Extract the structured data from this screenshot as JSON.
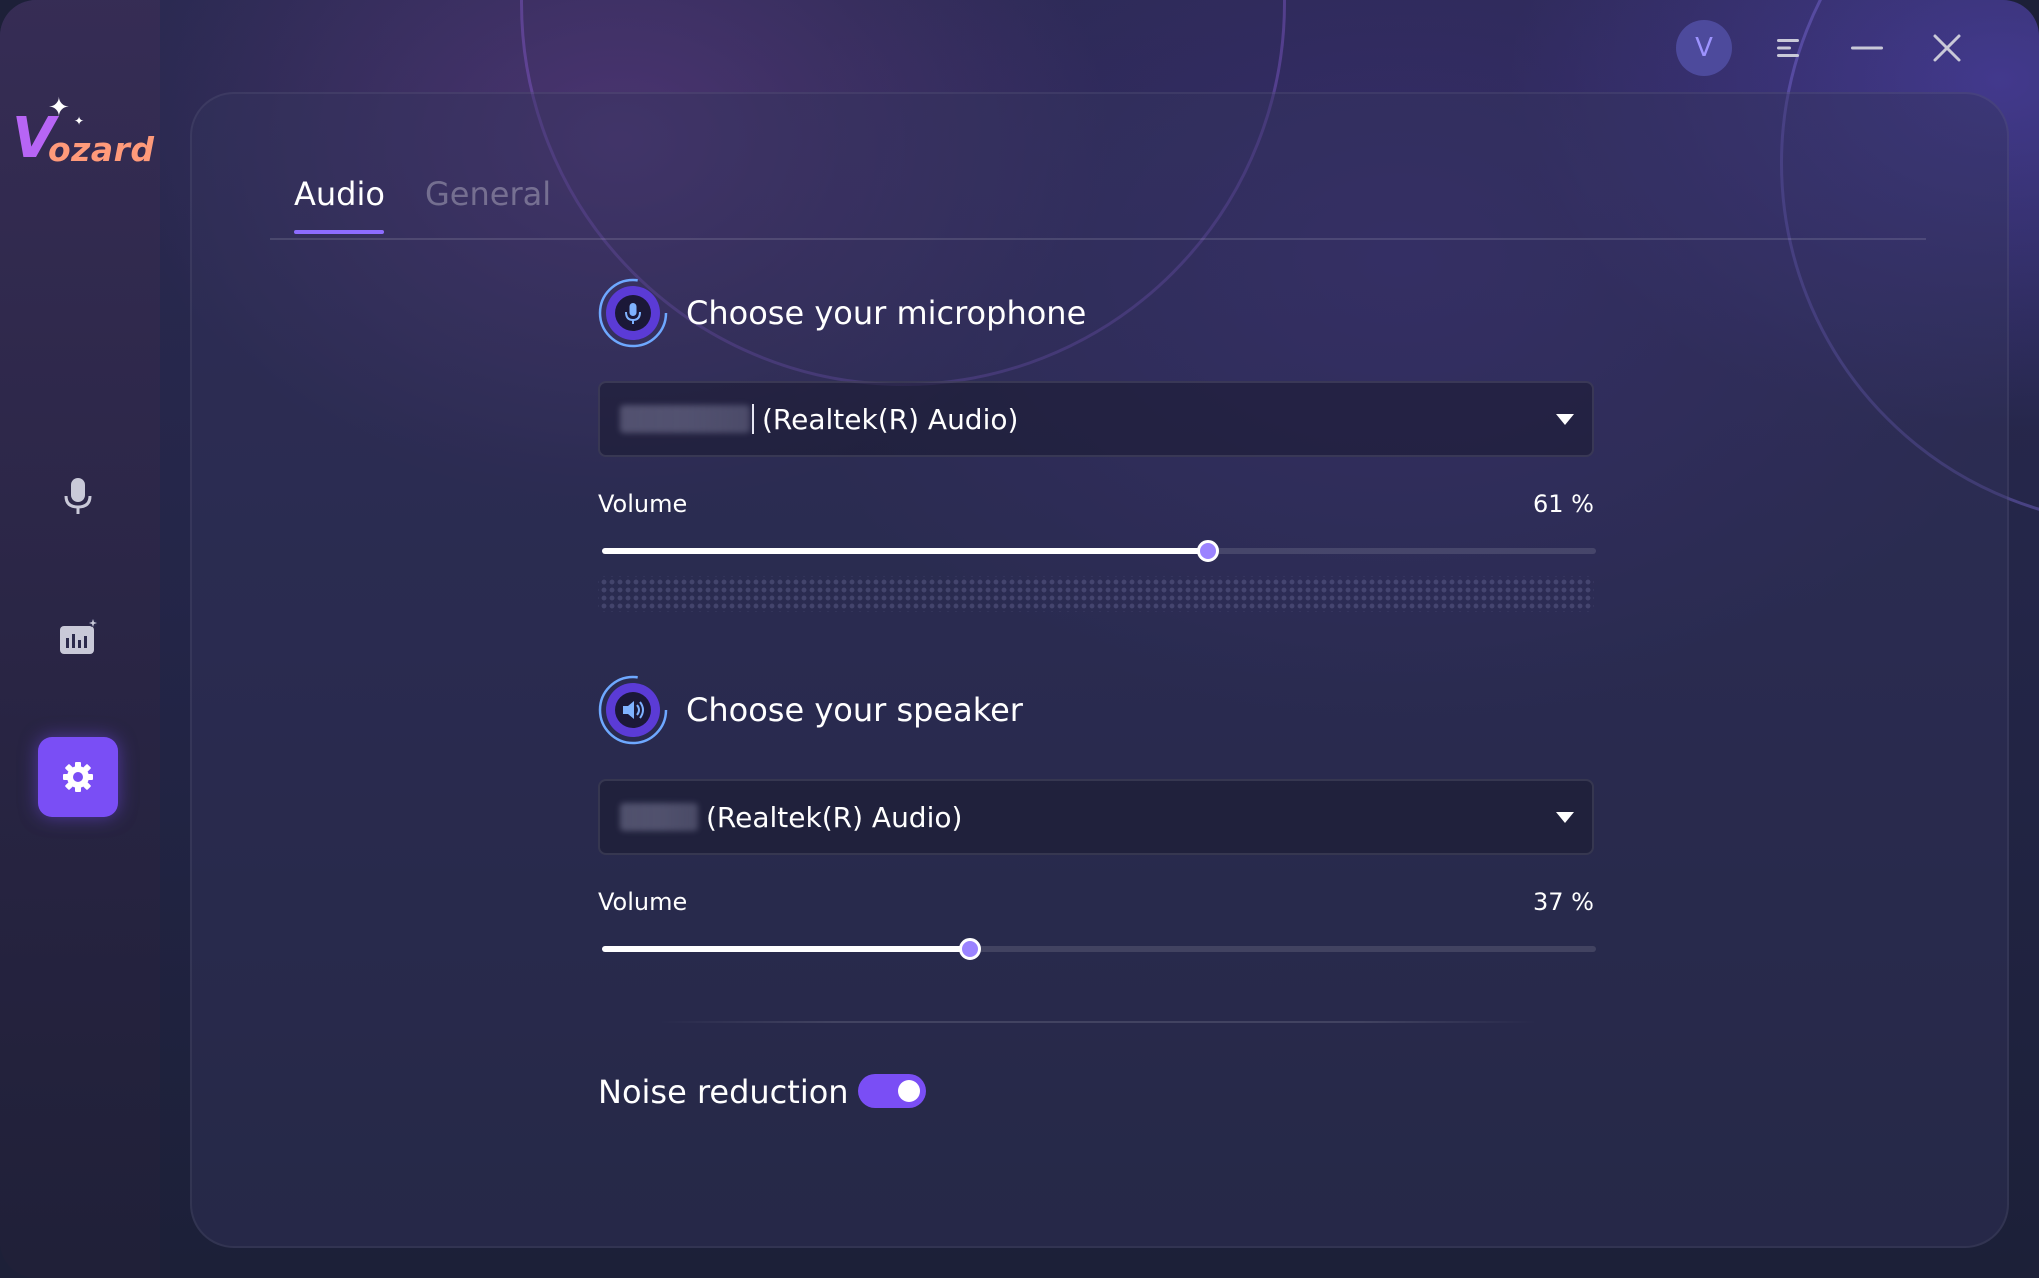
{
  "app": {
    "logo_initial": "V",
    "logo_rest": "ozard",
    "user_initial": "V"
  },
  "sidebar": {
    "items": [
      {
        "name": "microphone",
        "icon": "microphone-icon",
        "active": false
      },
      {
        "name": "voice-library",
        "icon": "soundboard-icon",
        "active": false
      },
      {
        "name": "settings",
        "icon": "gear-icon",
        "active": true
      }
    ]
  },
  "tabs": [
    {
      "label": "Audio",
      "active": true
    },
    {
      "label": "General",
      "active": false
    }
  ],
  "microphone": {
    "title": "Choose your microphone",
    "device": "(Realtek(R) Audio)",
    "volume_label": "Volume",
    "volume_value": "61 %",
    "volume": 0.61
  },
  "speaker": {
    "title": "Choose your speaker",
    "device": "(Realtek(R) Audio)",
    "volume_label": "Volume",
    "volume_value": "37 %",
    "volume": 0.37
  },
  "noise_reduction": {
    "label": "Noise reduction",
    "enabled": true
  },
  "colors": {
    "accent": "#7a4ef5",
    "thumb": "#9b83ff",
    "background": "#232547"
  }
}
